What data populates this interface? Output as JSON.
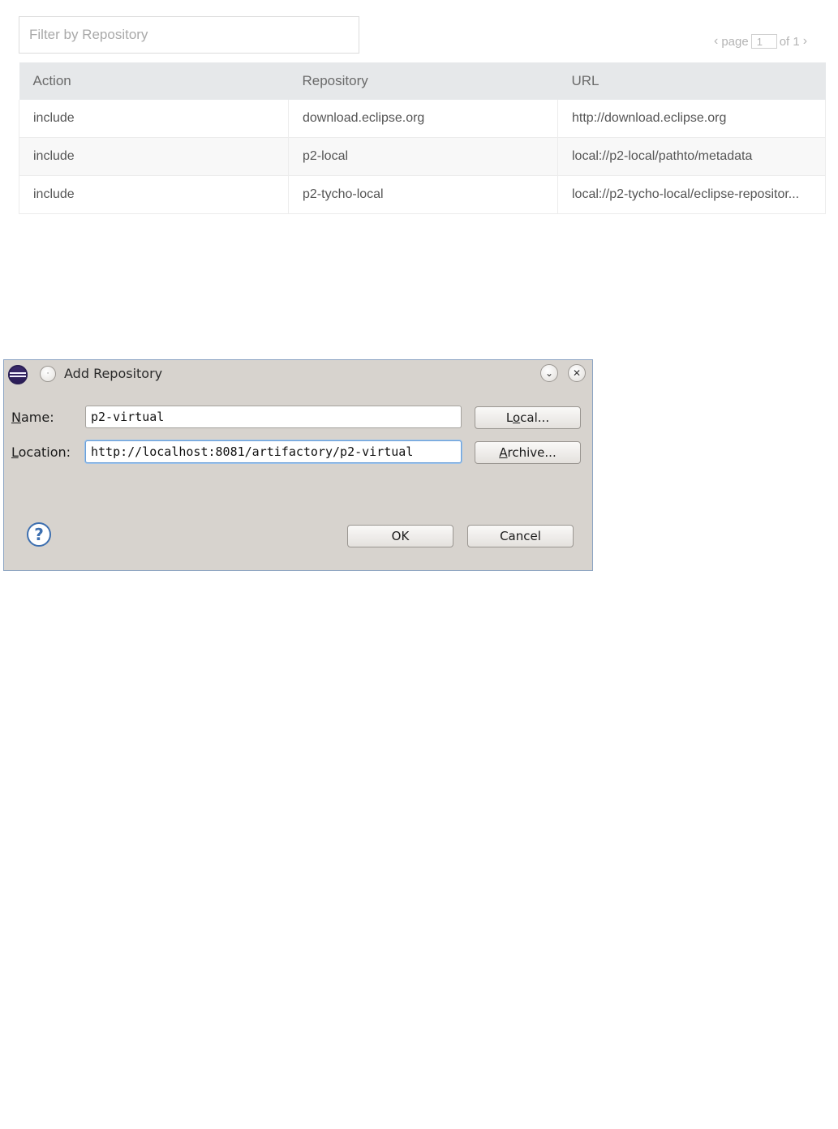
{
  "filter": {
    "placeholder": "Filter by Repository"
  },
  "pager": {
    "prev": "‹",
    "page_label": "page",
    "page_value": "1",
    "of_label": "of 1",
    "next": "›"
  },
  "table": {
    "headers": [
      "Action",
      "Repository",
      "URL"
    ],
    "rows": [
      [
        "include",
        "download.eclipse.org",
        "http://download.eclipse.org"
      ],
      [
        "include",
        "p2-local",
        "local://p2-local/pathto/metadata"
      ],
      [
        "include",
        "p2-tycho-local",
        "local://p2-tycho-local/eclipse-repositor..."
      ]
    ]
  },
  "dialog": {
    "title": "Add Repository",
    "name_label_u": "N",
    "name_label_rest": "ame:",
    "name_value": "p2-virtual",
    "location_label_u": "L",
    "location_label_rest": "ocation:",
    "location_value": "http://localhost:8081/artifactory/p2-virtual",
    "local_btn_pre": "L",
    "local_btn_u": "o",
    "local_btn_post": "cal...",
    "archive_btn_u": "A",
    "archive_btn_post": "rchive...",
    "ok_label": "OK",
    "cancel_label": "Cancel",
    "help_glyph": "?",
    "min_glyph": "⌄",
    "close_glyph": "✕",
    "menu_glyph": "·"
  }
}
